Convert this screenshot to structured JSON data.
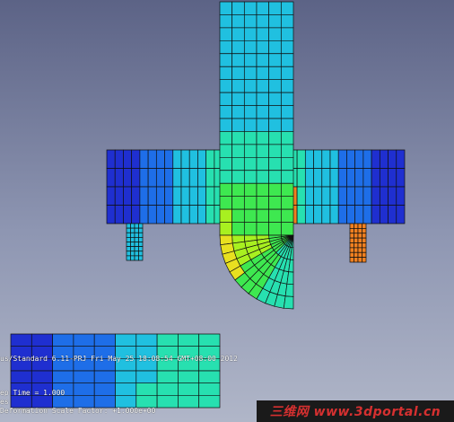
{
  "viewport": {
    "background_top": "#5c6386",
    "background_bottom": "#b0b6c8"
  },
  "model": {
    "mesh_line_color": "#101010",
    "contour_colors": [
      "#1f2fd0",
      "#1e6ee8",
      "#20c0e0",
      "#27e0b0",
      "#3ee850",
      "#a8f020",
      "#e8e020",
      "#f08020",
      "#e02010"
    ]
  },
  "info_block": {
    "job_line": "us/Standard 6.11-PRJ    Fri May 25 18:08:54 GMT+08:00 2012",
    "step_time_line": "ep Time =    1.000",
    "var_line": "es",
    "deformation_line": "Deformation Scale Factor: +1.000e+00"
  },
  "watermark": {
    "text": "三维网 www.3dportal.cn"
  }
}
